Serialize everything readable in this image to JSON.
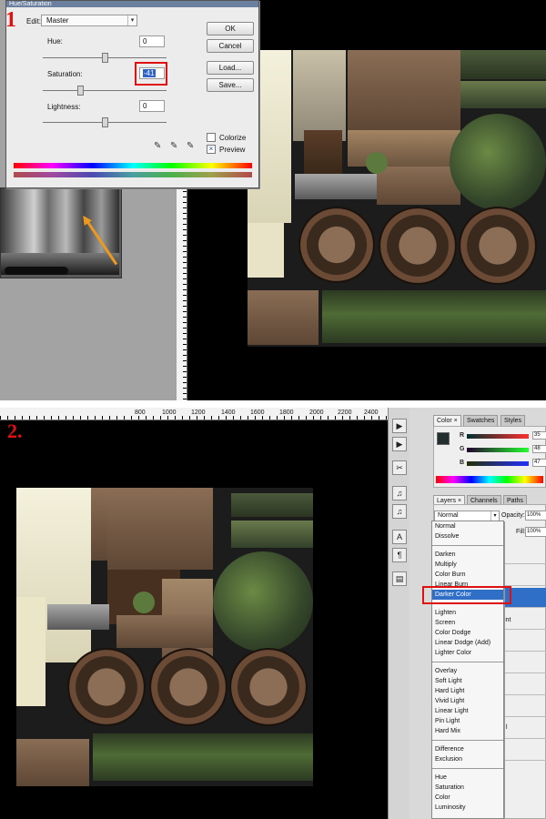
{
  "step1": {
    "label": "1"
  },
  "step2": {
    "label": "2."
  },
  "dialog": {
    "title": "Hue/Saturation",
    "edit_label": "Edit:",
    "edit_value": "Master",
    "hue_label": "Hue:",
    "hue_value": "0",
    "saturation_label": "Saturation:",
    "saturation_value": "-41",
    "lightness_label": "Lightness:",
    "lightness_value": "0",
    "ok_label": "OK",
    "cancel_label": "Cancel",
    "load_label": "Load...",
    "save_label": "Save...",
    "colorize_label": "Colorize",
    "colorize_checked": false,
    "preview_label": "Preview",
    "preview_checked": true,
    "preview_check_glyph": "×"
  },
  "ruler": {
    "ticks": [
      "800",
      "1000",
      "1200",
      "1400",
      "1600",
      "1800",
      "2000",
      "2200",
      "2400"
    ]
  },
  "color_panel": {
    "tabs": [
      "Color ×",
      "Swatches",
      "Styles"
    ],
    "r_label": "R",
    "r_value": "35",
    "g_label": "G",
    "g_value": "48",
    "b_label": "B",
    "b_value": "47",
    "foreground_color": "#232f2e"
  },
  "layers_panel": {
    "tabs": [
      "Layers ×",
      "Channels",
      "Paths"
    ],
    "blend_mode": "Normal",
    "opacity_label": "Opacity:",
    "opacity_value": "100%",
    "fill_label": "Fill:",
    "fill_value": "100%",
    "visible_fragment": "int",
    "visible_fragment_2": "l"
  },
  "blend_menu": {
    "groups": [
      [
        "Normal",
        "Dissolve"
      ],
      [
        "Darken",
        "Multiply",
        "Color Burn",
        "Linear Burn",
        "Darker Color"
      ],
      [
        "Lighten",
        "Screen",
        "Color Dodge",
        "Linear Dodge (Add)",
        "Lighter Color"
      ],
      [
        "Overlay",
        "Soft Light",
        "Hard Light",
        "Vivid Light",
        "Linear Light",
        "Pin Light",
        "Hard Mix"
      ],
      [
        "Difference",
        "Exclusion"
      ],
      [
        "Hue",
        "Saturation",
        "Color",
        "Luminosity"
      ]
    ],
    "highlighted": "Darker Color"
  },
  "tools": {
    "glyphs": [
      "▶",
      "✂",
      "♫",
      "A",
      "¶",
      "▤"
    ]
  },
  "colors": {
    "accent_red": "#e01010",
    "selection_blue": "#2f6fc8",
    "arrow_orange": "#ec9a1d"
  }
}
